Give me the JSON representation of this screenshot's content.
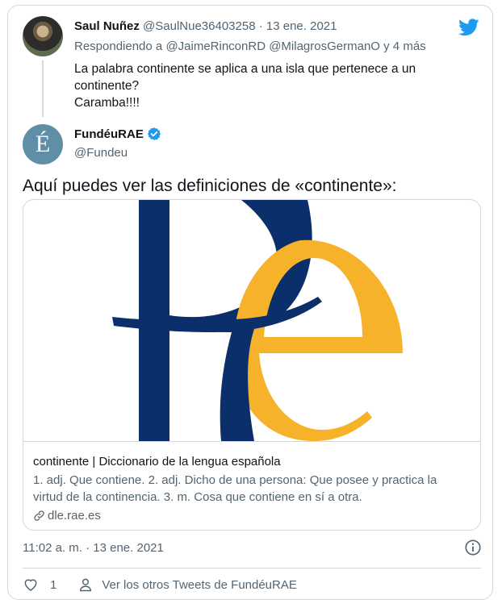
{
  "reply": {
    "author_name": "Saul Nuñez",
    "author_handle": "@SaulNue36403258",
    "separator": "·",
    "date": "13 ene. 2021",
    "replying_prefix": "Respondiendo a",
    "replying_to": "@JaimeRinconRD @MilagrosGermanO",
    "replying_suffix": "y 4 más",
    "text_lines": [
      "La palabra continente se aplica a una isla que pertenece a un",
      "continente?",
      "Caramba!!!!"
    ]
  },
  "tweet": {
    "author_name": "FundéuRAE",
    "author_handle": "@Fundeu",
    "avatar_glyph": "É",
    "text": "Aquí puedes ver las definiciones de «continente»:",
    "timestamp": "11:02 a. m. · 13 ene. 2021"
  },
  "link_card": {
    "title": "continente | Diccionario de la lengua española",
    "description_lines": [
      "1. adj. Que contiene. 2. adj. Dicho de una persona: Que posee y practica la",
      "virtud de la continencia. 3. m. Cosa que contiene en sí a otra."
    ],
    "domain": "dle.rae.es"
  },
  "actions": {
    "like_count": "1",
    "see_more_label": "Ver los otros Tweets de FundéuRAE"
  },
  "icons": {
    "brand": "twitter-bird-icon",
    "verified": "verified-badge-icon",
    "link": "link-icon",
    "info": "info-icon",
    "like": "heart-icon",
    "profile": "person-icon"
  },
  "colors": {
    "twitter_blue": "#1d9bf0",
    "rae_navy": "#0b2f6b",
    "rae_gold": "#f5b22a",
    "muted_text": "#536471",
    "border": "#cfd9de"
  }
}
